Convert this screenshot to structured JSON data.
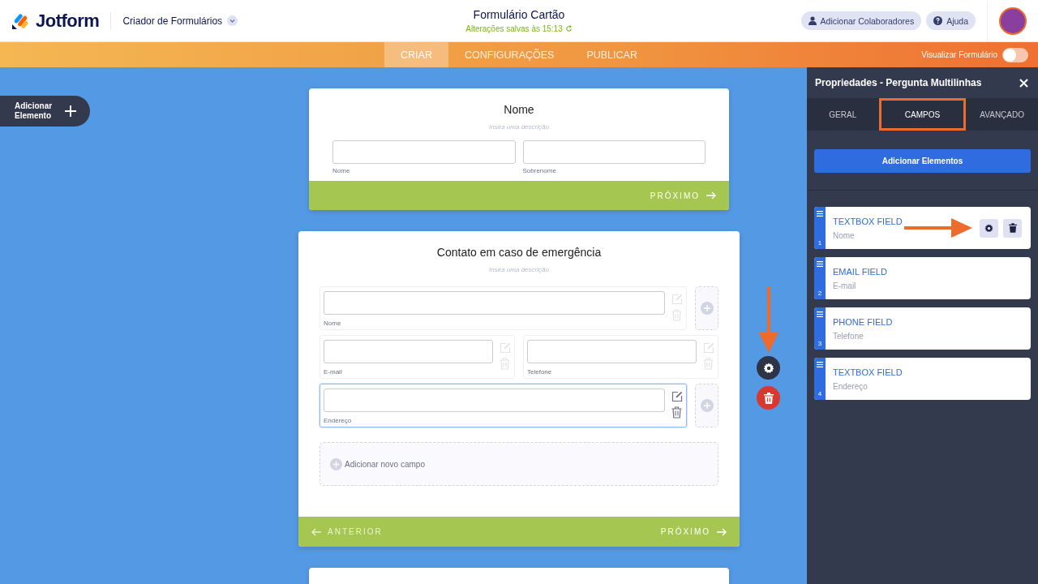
{
  "header": {
    "logo_text": "Jotform",
    "builder_menu": "Criador de Formulários",
    "form_title": "Formulário Cartão",
    "save_status": "Alterações salvas às 15:13",
    "buttons": [
      {
        "kind": "user",
        "label": "Adicionar Colaboradores"
      },
      {
        "kind": "help",
        "label": "Ajuda"
      }
    ]
  },
  "nav": {
    "tabs": [
      {
        "label": "CRIAR",
        "selected": true
      },
      {
        "label": "CONFIGURAÇÕES",
        "selected": false
      },
      {
        "label": "PUBLICAR",
        "selected": false
      }
    ],
    "preview_toggle": {
      "label": "Visualizar Formulário",
      "on": false
    }
  },
  "add_element_button": "Adicionar Elemento",
  "cards": [
    {
      "title": "Nome",
      "description_placeholder": "Insira uma descrição",
      "selected": false,
      "rows": [
        {
          "fields": [
            {
              "label": "Nome"
            },
            {
              "label": "Sobrenome"
            }
          ]
        }
      ],
      "footer": {
        "next": "PRÓXIMO"
      }
    },
    {
      "title": "Contato em caso de emergência",
      "description_placeholder": "Insira uma descrição",
      "selected": true,
      "rows": [
        {
          "fields": [
            {
              "label": "Nome"
            }
          ],
          "focused": false,
          "add_slot": true
        },
        {
          "fields": [
            {
              "label": "E-mail"
            },
            {
              "label": "Telefone"
            }
          ],
          "focused": false,
          "add_slot": false
        },
        {
          "fields": [
            {
              "label": "Endereço"
            }
          ],
          "focused": true,
          "add_slot": true
        }
      ],
      "add_field": "Adicionar novo campo",
      "footer": {
        "previous": "ANTERIOR",
        "next": "PRÓXIMO"
      }
    }
  ],
  "panel": {
    "title": "Propriedades - Pergunta Multilinhas",
    "tabs": [
      {
        "label": "GERAL",
        "selected": false
      },
      {
        "label": "CAMPOS",
        "selected": true
      },
      {
        "label": "AVANÇADO",
        "selected": false
      }
    ],
    "button": "Adicionar Elementos",
    "fields": [
      {
        "number": "1",
        "type": "TEXTBOX FIELD",
        "label": "Nome",
        "show_actions": true
      },
      {
        "number": "2",
        "type": "EMAIL FIELD",
        "label": "E-mail",
        "show_actions": false
      },
      {
        "number": "3",
        "type": "PHONE FIELD",
        "label": "Telefone",
        "show_actions": false
      },
      {
        "number": "4",
        "type": "TEXTBOX FIELD",
        "label": "Endereço",
        "show_actions": false
      }
    ]
  }
}
